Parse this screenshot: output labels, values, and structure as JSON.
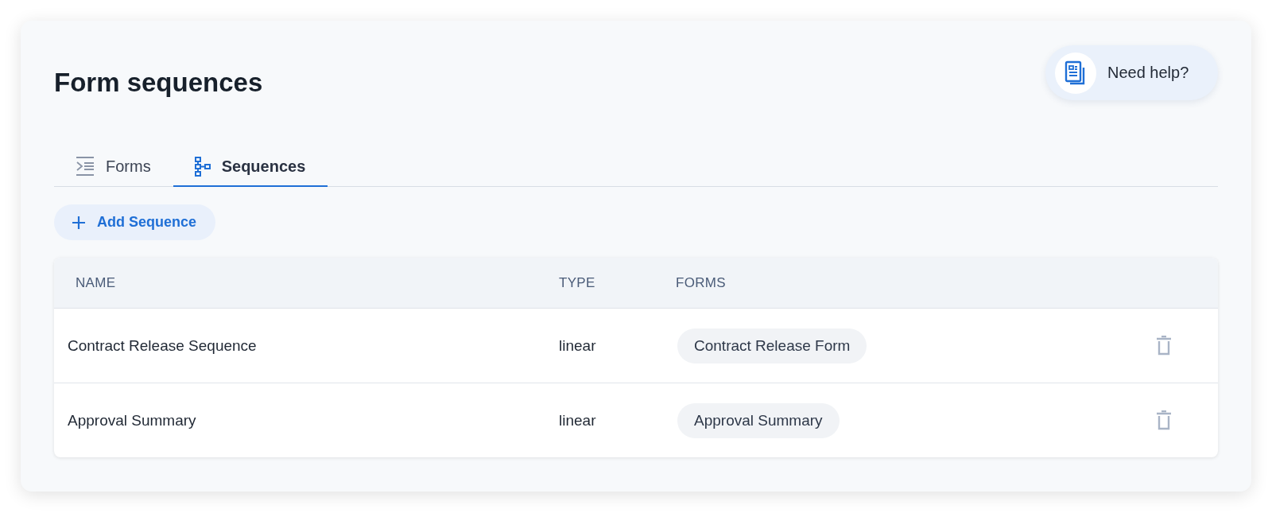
{
  "page": {
    "title": "Form sequences"
  },
  "help_button": {
    "label": "Need help?"
  },
  "tabs": [
    {
      "label": "Forms",
      "selected": false
    },
    {
      "label": "Sequences",
      "selected": true
    }
  ],
  "add_button": {
    "label": "Add Sequence"
  },
  "table": {
    "columns": [
      "NAME",
      "TYPE",
      "FORMS"
    ],
    "rows": [
      {
        "name": "Contract Release Sequence",
        "type": "linear",
        "forms": [
          "Contract Release Form"
        ]
      },
      {
        "name": "Approval Summary",
        "type": "linear",
        "forms": [
          "Approval Summary"
        ]
      }
    ]
  }
}
